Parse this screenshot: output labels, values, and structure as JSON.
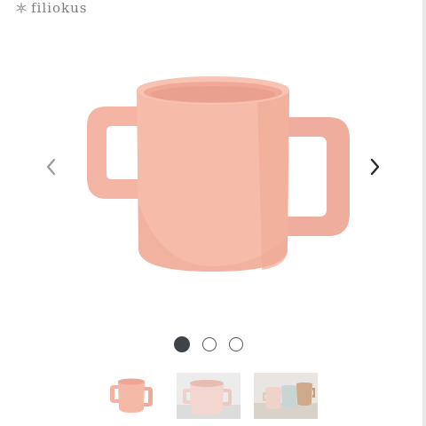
{
  "brand": {
    "name": "filiokus",
    "logo_icon": "snowflake-icon",
    "text_color": "#7c7c7c"
  },
  "carousel": {
    "prev_icon": "chevron-left-icon",
    "next_icon": "chevron-right-icon",
    "product_color": "#f4b8a6",
    "slides": [
      {
        "active": true,
        "image": "pink-cup-two-handles"
      },
      {
        "active": false,
        "image": "pink-cup-on-table"
      },
      {
        "active": false,
        "image": "three-cups-colors"
      }
    ],
    "active_index": 0
  },
  "colors": {
    "dot_active": "#3f4347",
    "dot_border": "#555555"
  }
}
